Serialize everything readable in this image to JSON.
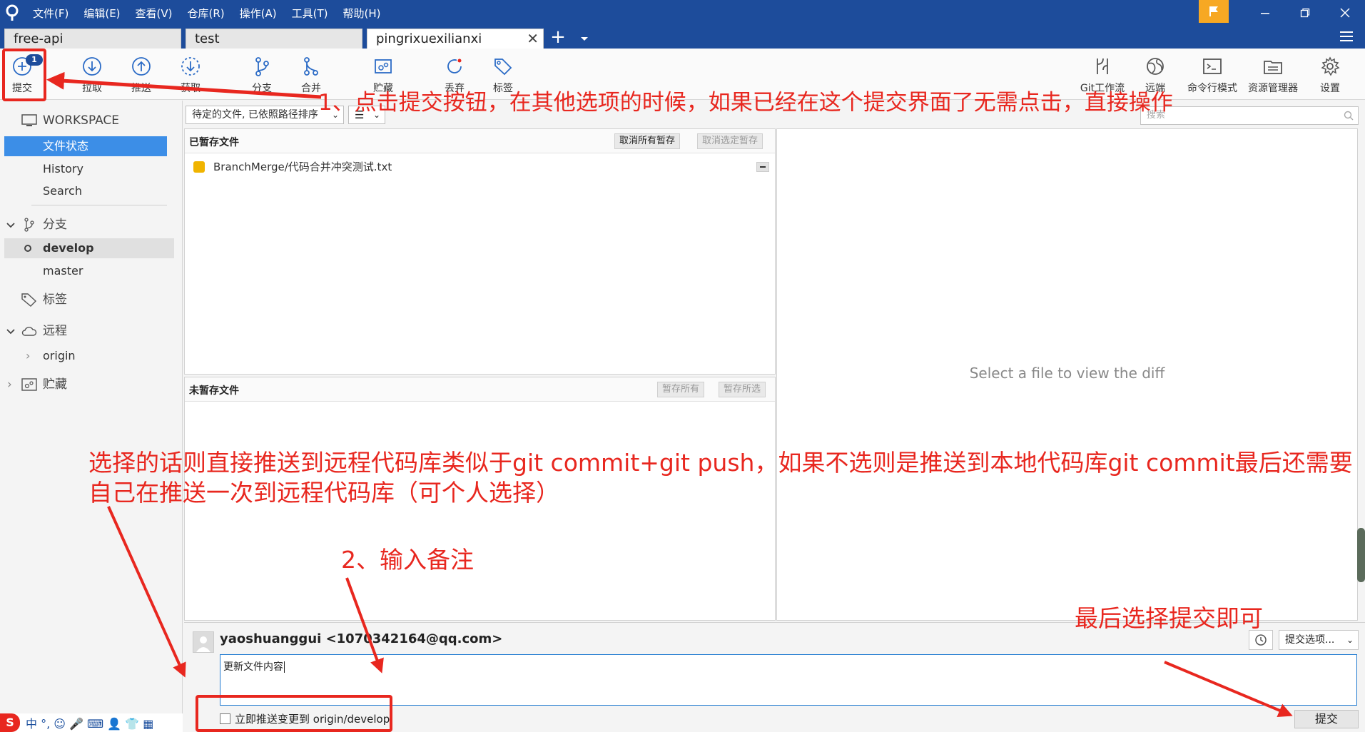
{
  "menu": {
    "items": [
      "文件(F)",
      "编辑(E)",
      "查看(V)",
      "仓库(R)",
      "操作(A)",
      "工具(T)",
      "帮助(H)"
    ]
  },
  "tabs": [
    "free-api",
    "test",
    "pingrixuexilianxi"
  ],
  "toolbar": {
    "left": [
      {
        "label": "提交",
        "icon": "plus-circle-icon"
      },
      {
        "label": "拉取",
        "icon": "arrow-down-circle-icon"
      },
      {
        "label": "推送",
        "icon": "arrow-up-circle-icon"
      },
      {
        "label": "获取",
        "icon": "download-dashed-icon"
      },
      {
        "label": "分支",
        "icon": "branch-icon"
      },
      {
        "label": "合并",
        "icon": "merge-icon"
      },
      {
        "label": "贮藏",
        "icon": "stash-icon"
      },
      {
        "label": "丢弃",
        "icon": "discard-icon"
      },
      {
        "label": "标签",
        "icon": "tag-icon"
      }
    ],
    "right": [
      {
        "label": "Git工作流",
        "icon": "git-flow-icon"
      },
      {
        "label": "远端",
        "icon": "globe-icon"
      },
      {
        "label": "命令行模式",
        "icon": "terminal-icon"
      },
      {
        "label": "资源管理器",
        "icon": "folder-icon"
      },
      {
        "label": "设置",
        "icon": "gear-icon"
      }
    ],
    "commit_badge": "1"
  },
  "sidebar": {
    "workspace": "WORKSPACE",
    "workspace_items": [
      "文件状态",
      "History",
      "Search"
    ],
    "branches_title": "分支",
    "branches": [
      "develop",
      "master"
    ],
    "tags_title": "标签",
    "remote_title": "远程",
    "remotes": [
      "origin"
    ],
    "stash_title": "贮藏"
  },
  "ime_bar": "中 °, ☺ 🎤 ⌨ 👤 👕 ▦",
  "filter": {
    "sort_label": "待定的文件, 已依照路径排序",
    "view_label": "☰",
    "search_placeholder": "搜索"
  },
  "staged": {
    "title": "已暂存文件",
    "buttons": [
      "取消所有暂存",
      "取消选定暂存"
    ],
    "files": [
      "BranchMerge/代码合并冲突测试.txt"
    ]
  },
  "unstaged": {
    "title": "未暂存文件",
    "buttons": [
      "暂存所有",
      "暂存所选"
    ]
  },
  "diff": {
    "placeholder": "Select a file to view the diff"
  },
  "commit": {
    "author": "yaoshuanggui <1070342164@qq.com>",
    "message": "更新文件内容",
    "options_label": "提交选项...",
    "push_label": "立即推送变更到 origin/develop",
    "commit_label": "提交"
  },
  "annotations": {
    "step1": "1、点击提交按钮，在其他选项的时候，如果已经在这个提交界面了无需点击，直接操作",
    "push_note_line1": "选择的话则直接推送到远程代码库类似于git commit+git push，如果不选则是推送到本地代码库git commit最后还需要",
    "push_note_line2": "自己在推送一次到远程代码库（可个人选择）",
    "step2": "2、输入备注",
    "final": "最后选择提交即可"
  },
  "colors": {
    "titlebar": "#1d4c9b",
    "accent": "#3c8ee7",
    "annotation": "#e8271f",
    "flag": "#f7a823"
  }
}
